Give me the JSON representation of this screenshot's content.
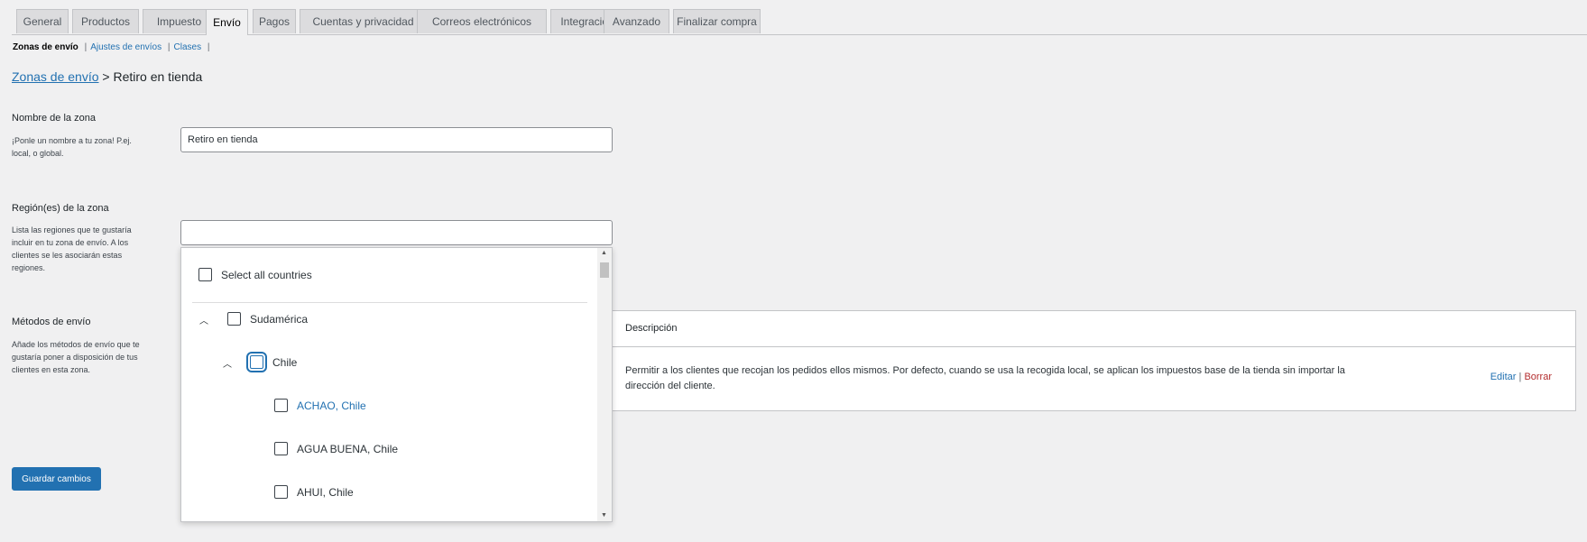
{
  "tabs": [
    {
      "label": "General"
    },
    {
      "label": "Productos"
    },
    {
      "label": "Impuesto"
    },
    {
      "label": "Envío"
    },
    {
      "label": "Pagos"
    },
    {
      "label": "Cuentas y privacidad"
    },
    {
      "label": "Correos electrónicos"
    },
    {
      "label": "Integración"
    },
    {
      "label": "Avanzado"
    },
    {
      "label": "Finalizar compra"
    }
  ],
  "subnav": {
    "current": "Zonas de envío",
    "sep1": "|",
    "settings": "Ajustes de envíos",
    "sep2": "|",
    "classes": "Clases",
    "sep3": "|"
  },
  "breadcrumb": {
    "link": "Zonas de envío",
    "separator": ">",
    "current": "Retiro en tienda"
  },
  "zone_name": {
    "title": "Nombre de la zona",
    "desc": "¡Ponle un nombre a tu zona! P.ej. local, o global.",
    "value": "Retiro en tienda"
  },
  "zone_regions": {
    "title": "Región(es) de la zona",
    "desc": "Lista las regiones que te gustaría incluir en tu zona de envío. A los clientes se les asociarán estas regiones.",
    "value": ""
  },
  "dropdown": {
    "select_all": "Select all countries",
    "continent": "Sudamérica",
    "country": "Chile",
    "items": [
      "ACHAO, Chile",
      "AGUA BUENA, Chile",
      "AHUI, Chile"
    ],
    "scroll_up": "▲",
    "scroll_down": "▼"
  },
  "shipping_methods": {
    "title": "Métodos de envío",
    "desc": "Añade los métodos de envío que te gustaría poner a disposición de tus clientes en esta zona.",
    "column_header": "Descripción",
    "row_description": "Permitir a los clientes que recojan los pedidos ellos mismos. Por defecto, cuando se usa la recogida local, se aplican los impuestos base de la tienda sin importar la dirección del cliente.",
    "edit": "Editar",
    "action_sep": "|",
    "delete": "Borrar"
  },
  "save_label": "Guardar cambios",
  "icons": {
    "expanded": "chevron-up-icon"
  },
  "colors": {
    "accent": "#2271b1",
    "delete": "#b32d2e",
    "background": "#f0f0f1"
  }
}
